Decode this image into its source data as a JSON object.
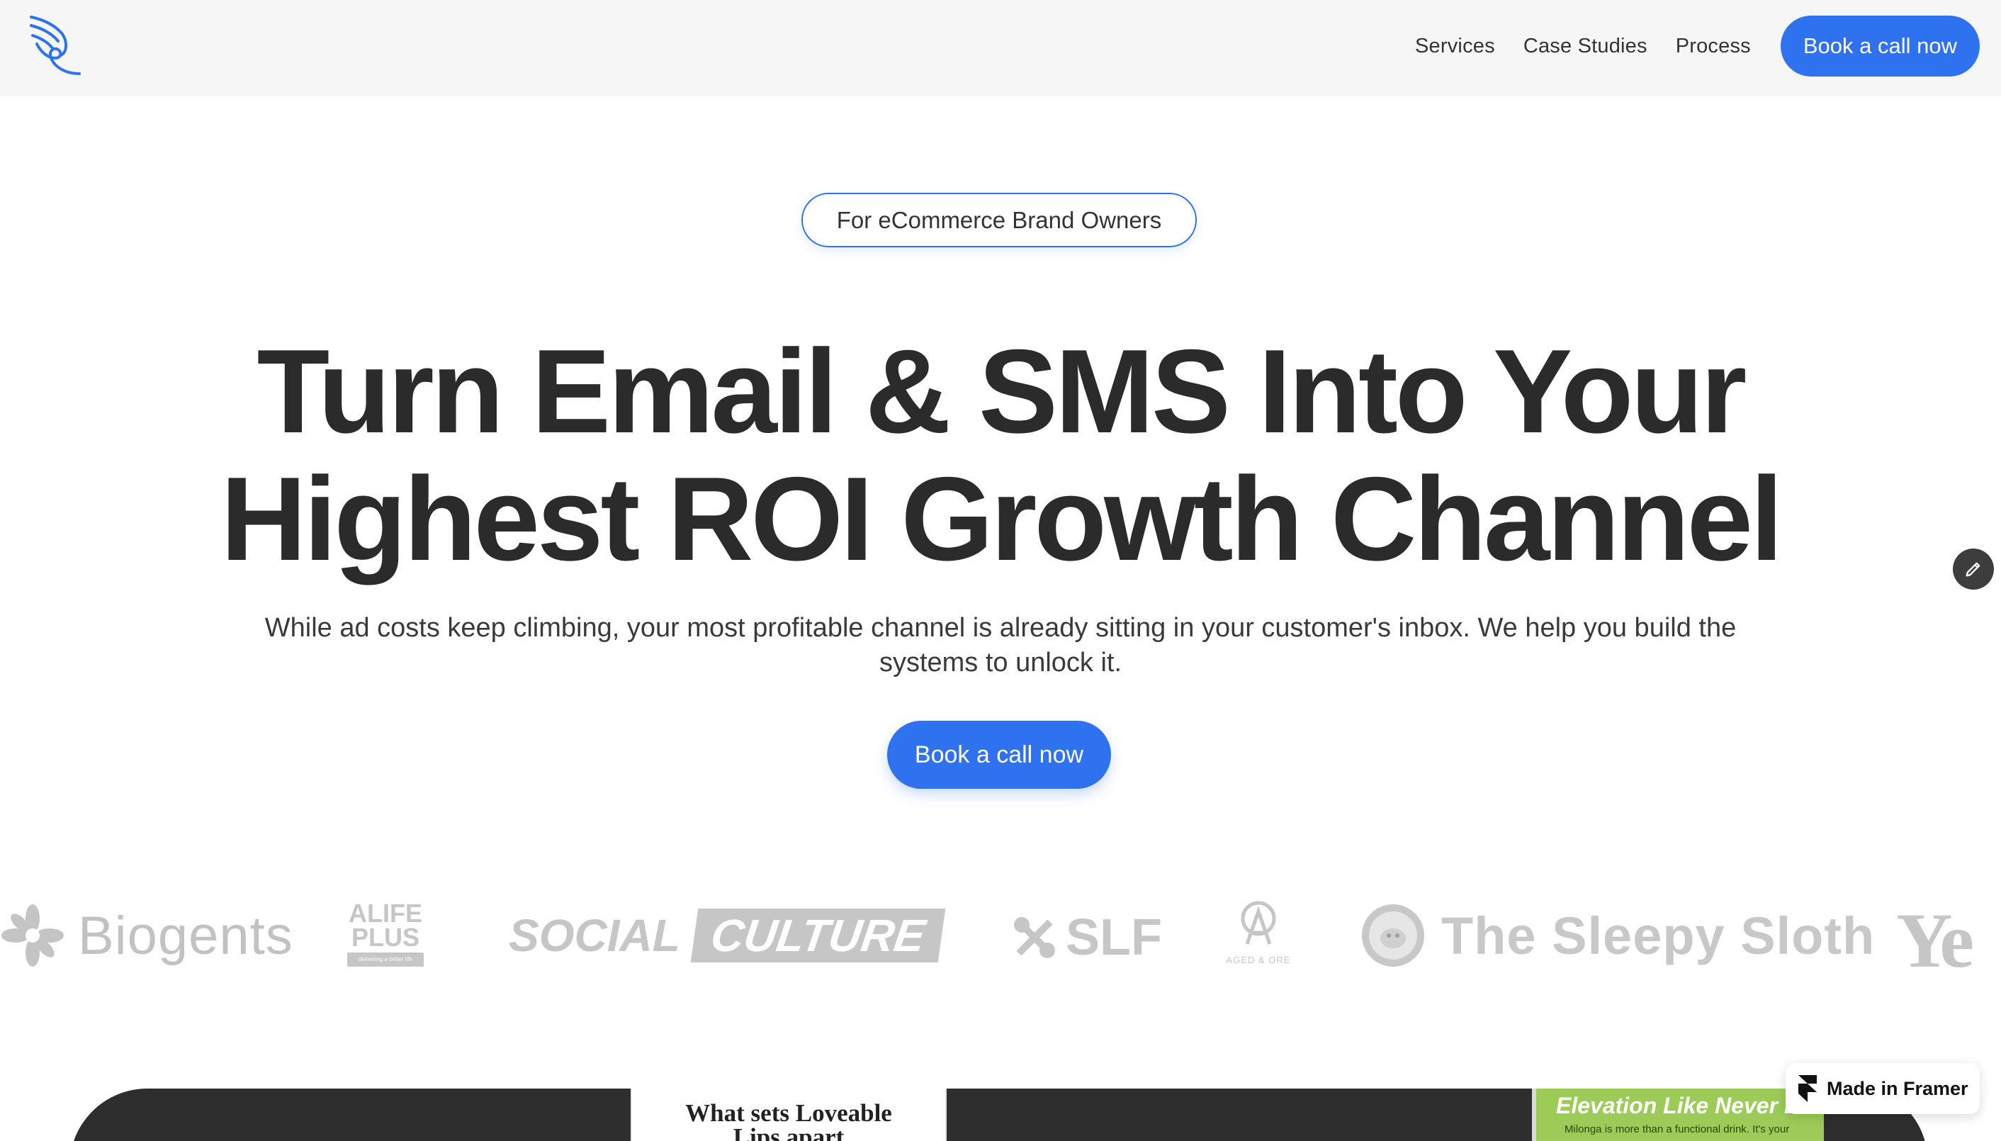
{
  "nav": {
    "links": [
      "Services",
      "Case Studies",
      "Process"
    ],
    "cta_label": "Book a call now"
  },
  "hero": {
    "pill": "For eCommerce Brand Owners",
    "headline_line1": "Turn Email & SMS Into Your",
    "headline_line2": "Highest ROI Growth Channel",
    "subheadline_line1": "While ad costs keep climbing, your most profitable channel is already sitting in your customer's inbox. We help you build the",
    "subheadline_line2": "systems to unlock it.",
    "cta_label": "Book a call now"
  },
  "logos": {
    "biogents": "Biogents",
    "alife_line1": "ALIFE",
    "alife_line2": "PLUS",
    "alife_tag": "delivering a better life",
    "social_left": "SOCIAL",
    "social_right": "CULTURE",
    "slf": "SLF",
    "aged_sub": "AGED & ORE",
    "sloth": "The Sleepy Sloth",
    "ye": "Ye"
  },
  "preview": {
    "mid_title_line1": "What sets Loveable",
    "mid_title_line2": "Lips apart",
    "green_title": "Elevation Like Never Before",
    "green_sub": "Milonga is more than a functional drink. It's your"
  },
  "badge": {
    "label": "Made in Framer"
  },
  "colors": {
    "accent": "#2f72f0",
    "text": "#2b2b2b",
    "nav_bg": "#f6f6f6",
    "logo_gray": "#c6c6c6"
  },
  "icons": [
    "winged-logo-icon",
    "edit-pencil-icon",
    "framer-icon"
  ]
}
